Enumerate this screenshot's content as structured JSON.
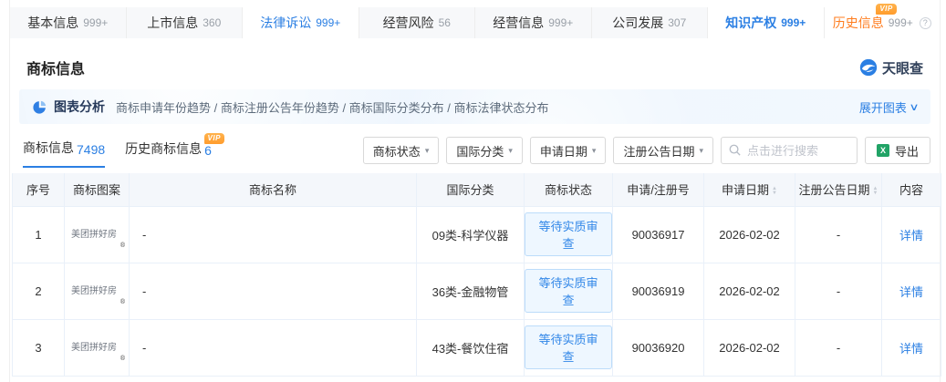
{
  "vip_label": "VIP",
  "help_label": "?",
  "tm_symbol": "®",
  "tabs": [
    {
      "label": "基本信息",
      "count": "999+"
    },
    {
      "label": "上市信息",
      "count": "360"
    },
    {
      "label": "法律诉讼",
      "count": "999+"
    },
    {
      "label": "经营风险",
      "count": "56"
    },
    {
      "label": "经营信息",
      "count": "999+"
    },
    {
      "label": "公司发展",
      "count": "307"
    },
    {
      "label": "知识产权",
      "count": "999+"
    },
    {
      "label": "历史信息",
      "count": "999+"
    }
  ],
  "section": {
    "title": "商标信息",
    "brand": "天眼查"
  },
  "chart_bar": {
    "title": "图表分析",
    "links": "商标申请年份趋势 / 商标注册公告年份趋势 / 商标国际分类分布 / 商标法律状态分布",
    "expand_label": "展开图表",
    "chevron": "∨"
  },
  "subtabs": [
    {
      "label": "商标信息",
      "count": "7498"
    },
    {
      "label": "历史商标信息",
      "count": "6"
    }
  ],
  "filters": [
    {
      "label": "商标状态"
    },
    {
      "label": "国际分类"
    },
    {
      "label": "申请日期"
    },
    {
      "label": "注册公告日期"
    }
  ],
  "search_placeholder": "点击进行搜索",
  "export_label": "导出",
  "table": {
    "columns": [
      "序号",
      "商标图案",
      "商标名称",
      "国际分类",
      "商标状态",
      "申请/注册号",
      "申请日期",
      "注册公告日期",
      "内容"
    ],
    "rows": [
      {
        "seq": "1",
        "mark_text": "美团拼好房",
        "name": "-",
        "intl_class": "09类-科学仪器",
        "status": "等待实质审查",
        "reg_no": "90036917",
        "apply_date": "2026-02-02",
        "pub_date": "-",
        "action": "详情"
      },
      {
        "seq": "2",
        "mark_text": "美团拼好房",
        "name": "-",
        "intl_class": "36类-金融物管",
        "status": "等待实质审查",
        "reg_no": "90036919",
        "apply_date": "2026-02-02",
        "pub_date": "-",
        "action": "详情"
      },
      {
        "seq": "3",
        "mark_text": "美团拼好房",
        "name": "-",
        "intl_class": "43类-餐饮住宿",
        "status": "等待实质审查",
        "reg_no": "90036920",
        "apply_date": "2026-02-02",
        "pub_date": "-",
        "action": "详情"
      }
    ]
  },
  "colors": {
    "primary_blue": "#2b7fe3",
    "tab_orange": "#ff7d1f",
    "vip_orange": "#ffa438",
    "status_blue": "#3287e8",
    "status_bg": "#eef7ff",
    "excel_green": "#21a366"
  }
}
